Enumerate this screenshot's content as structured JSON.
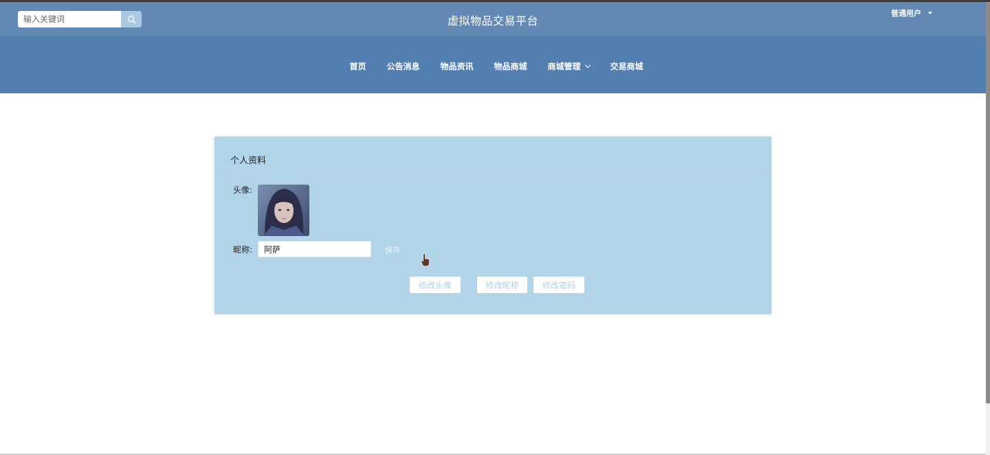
{
  "header": {
    "search_placeholder": "输入关键词",
    "search_icon": "search-icon",
    "site_title": "虚拟物品交易平台",
    "user_menu_label": "普通用户"
  },
  "nav": {
    "items": [
      {
        "label": "首页"
      },
      {
        "label": "公告消息"
      },
      {
        "label": "物品资讯"
      },
      {
        "label": "物品商城"
      },
      {
        "label": "商城管理",
        "has_dropdown": true
      },
      {
        "label": "交易商城"
      }
    ]
  },
  "profile": {
    "title": "个人资料",
    "avatar_label": "头像:",
    "nickname_label": "昵称:",
    "nickname_value": "阿萨",
    "save_label": "保存",
    "buttons": {
      "change_avatar": "修改头像",
      "change_nickname": "修改昵称",
      "change_password": "修改密码"
    }
  },
  "colors": {
    "topbar": "#6189b4",
    "navbar": "#527fb0",
    "card": "#b2d4e9"
  }
}
